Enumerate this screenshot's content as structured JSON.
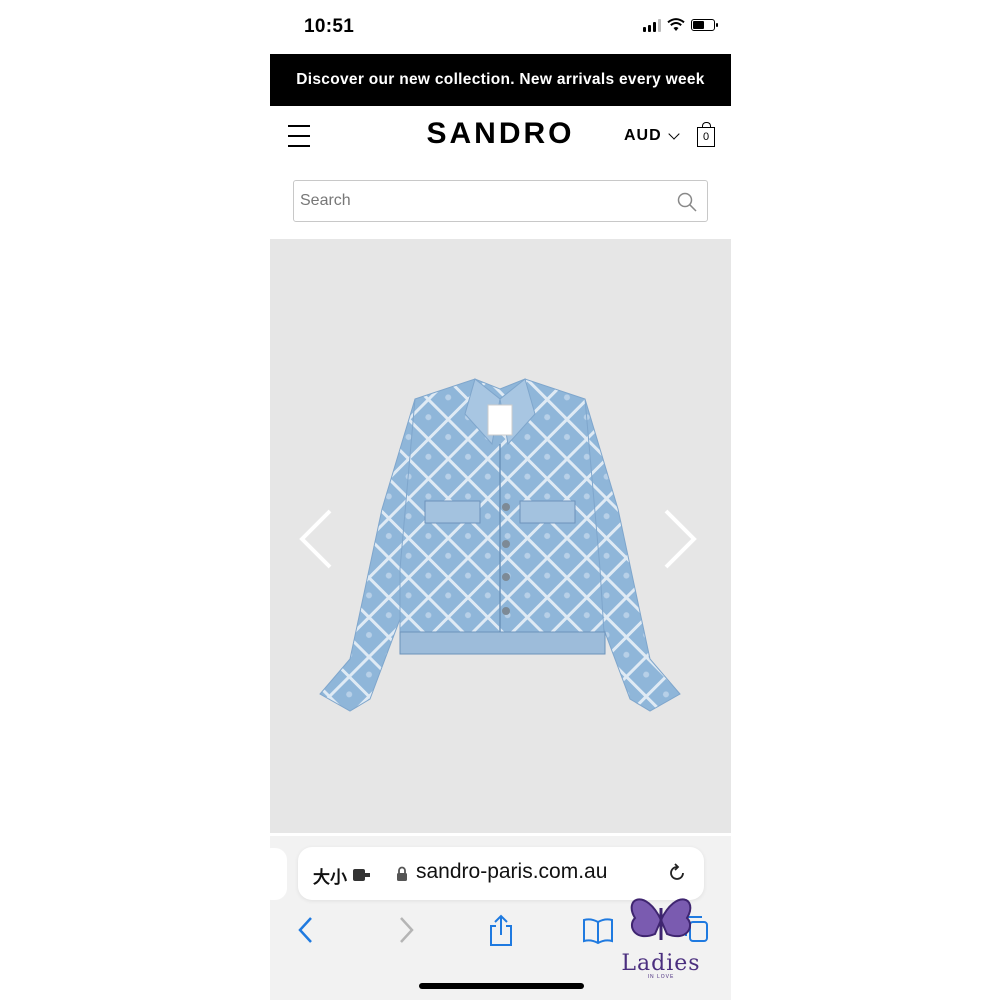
{
  "status_bar": {
    "time": "10:51"
  },
  "promo": {
    "text": "Discover our new collection. New arrivals every week"
  },
  "header": {
    "logo": "SANDRO",
    "currency": "AUD",
    "bag_count": "0"
  },
  "search": {
    "placeholder": "Search"
  },
  "product": {
    "image_icon": "denim-jacket-image"
  },
  "browser": {
    "text_size_label": "大小",
    "url": "sandro-paris.com.au"
  },
  "watermark": {
    "text": "Ladies",
    "subtext": "IN LOVE"
  },
  "colors": {
    "banner": "#000000",
    "image_bg": "#e6e6e6",
    "browser_bg": "#f2f2f2",
    "accent_blue": "#1f7ae0",
    "watermark": "#4b2f7f"
  }
}
